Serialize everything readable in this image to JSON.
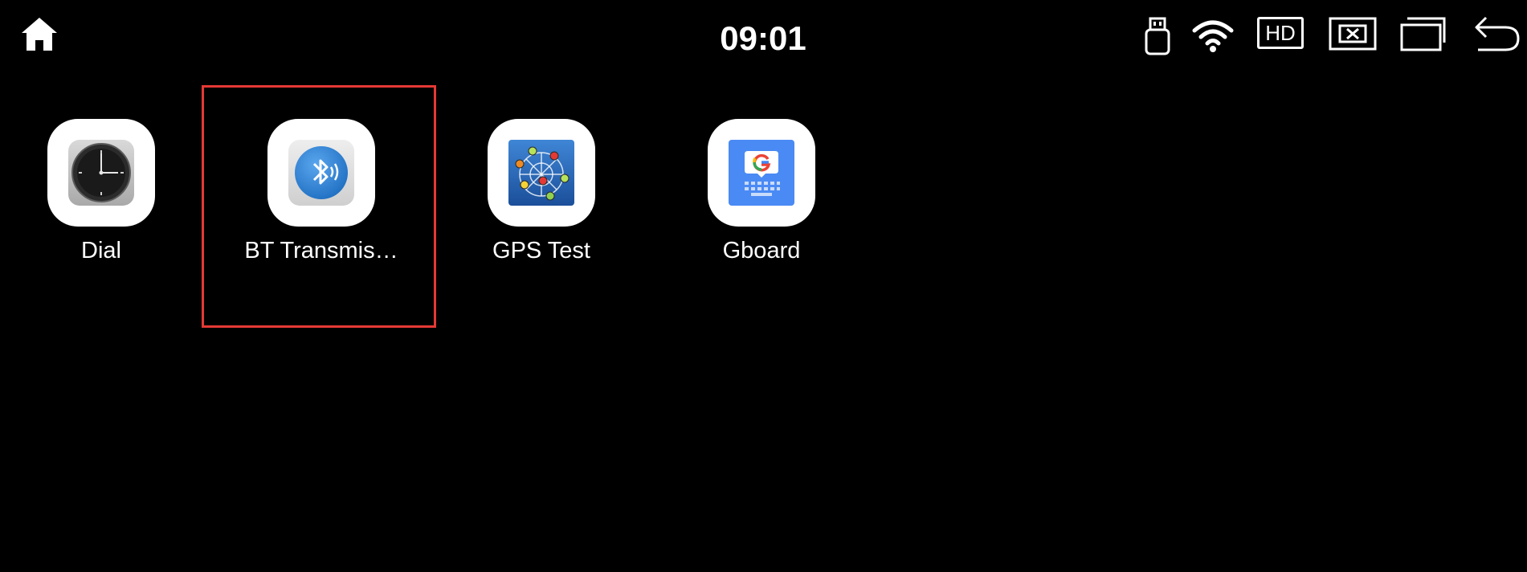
{
  "status_bar": {
    "time": "09:01",
    "icons": [
      "home-icon",
      "usb-icon",
      "wifi-icon",
      "hd-icon",
      "close-window-icon",
      "recent-apps-icon",
      "back-icon"
    ],
    "hd_label": "HD"
  },
  "apps": [
    {
      "label": "Dial",
      "icon": "clock-dial-icon"
    },
    {
      "label": "BT Transmis…",
      "icon": "bluetooth-icon"
    },
    {
      "label": "GPS Test",
      "icon": "gps-test-icon"
    },
    {
      "label": "Gboard",
      "icon": "gboard-icon"
    }
  ],
  "selection": {
    "target": "BT Transmis…",
    "color": "#e53935"
  },
  "colors": {
    "background": "#000000",
    "icon_tile": "#ffffff",
    "bluetooth_blue": "#2f7fd0",
    "gboard_blue": "#4a8af4"
  }
}
